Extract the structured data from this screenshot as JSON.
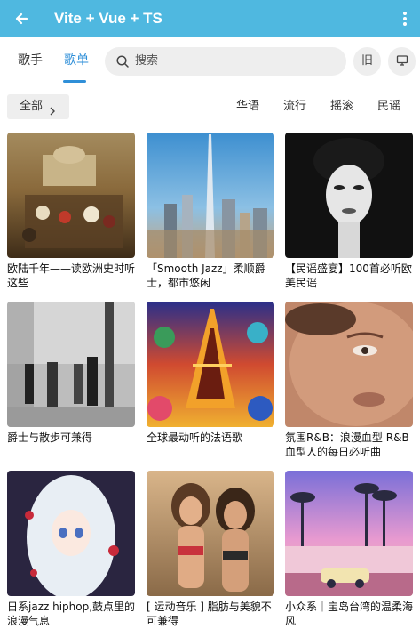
{
  "app_bar": {
    "title": "Vite + Vue + TS",
    "back_icon": "arrow-left-icon",
    "menu_icon": "more-vertical-icon",
    "color": "#4fb8e0"
  },
  "tabs": [
    {
      "label": "歌手",
      "active": false
    },
    {
      "label": "歌单",
      "active": true
    }
  ],
  "accent_color": "#2f8fd8",
  "search": {
    "placeholder": "搜索",
    "icon": "search-icon"
  },
  "actions": {
    "old_label": "旧",
    "monitor_icon": "monitor-icon"
  },
  "filter": {
    "all_label": "全部",
    "genres": [
      "华语",
      "流行",
      "摇滚",
      "民谣"
    ]
  },
  "playlists": [
    {
      "title": "欧陆千年——读欧洲史时听这些"
    },
    {
      "title": "「Smooth Jazz」柔顺爵士，都市悠闲"
    },
    {
      "title": "【民谣盛宴】100首必听欧美民谣"
    },
    {
      "title": "爵士与散步可兼得"
    },
    {
      "title": "全球最动听的法语歌"
    },
    {
      "title": "氛围R&B：浪漫血型 R&B血型人的每日必听曲"
    },
    {
      "title": "日系jazz hiphop,鼓点里的浪漫气息"
    },
    {
      "title": "[ 运动音乐 ] 脂肪与美貌不可兼得"
    },
    {
      "title": "小众系｜宝岛台湾的温柔海风"
    }
  ]
}
